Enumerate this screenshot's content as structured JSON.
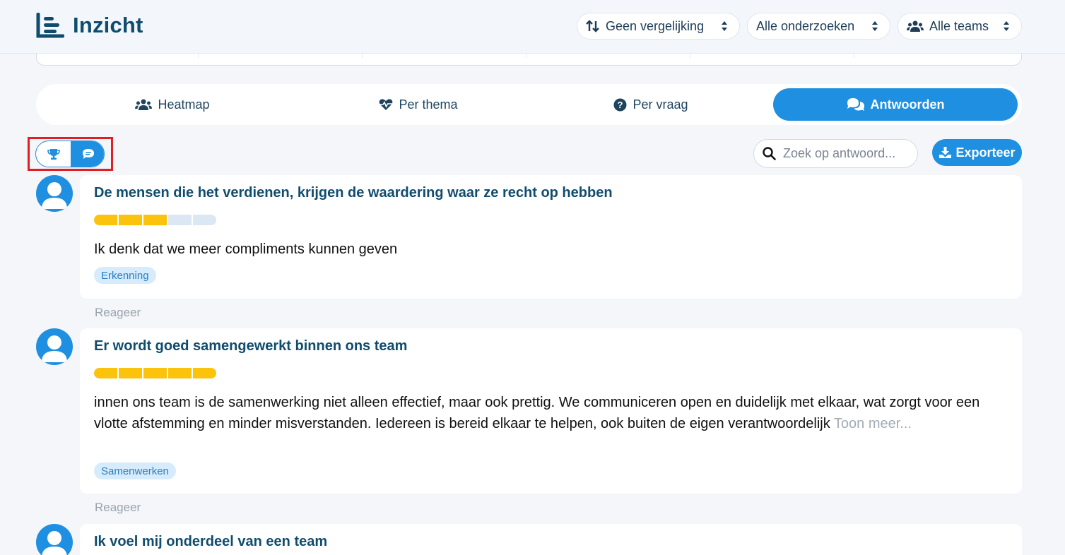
{
  "header": {
    "app_title": "Inzicht",
    "compare_select": "Geen vergelijking",
    "survey_select": "Alle onderzoeken",
    "team_select": "Alle teams"
  },
  "tabs": [
    {
      "label": "Heatmap"
    },
    {
      "label": "Per thema"
    },
    {
      "label": "Per vraag"
    },
    {
      "label": "Antwoorden"
    }
  ],
  "search": {
    "placeholder": "Zoek op antwoord..."
  },
  "export_label": "Exporteer",
  "answers": [
    {
      "question": "De mensen die het verdienen, krijgen de waardering waar ze recht op hebben",
      "rating": 3,
      "rating_max": 5,
      "text": "Ik denk dat we meer compliments kunnen geven",
      "tag": "Erkenning",
      "reply": "Reageer"
    },
    {
      "question": "Er wordt goed samengewerkt binnen ons team",
      "rating": 5,
      "rating_max": 5,
      "text": "innen ons team is de samenwerking niet alleen effectief, maar ook prettig. We communiceren open en duidelijk met elkaar, wat zorgt voor een vlotte afstemming en minder misverstanden. Iedereen is bereid elkaar te helpen, ook buiten de eigen verantwoordelijk",
      "more": "Toon meer...",
      "tag": "Samenwerken",
      "reply": "Reageer"
    },
    {
      "question": "Ik voel mij onderdeel van een team"
    }
  ],
  "colors": {
    "primary": "#1e8fe1",
    "title": "#0f4c6e",
    "rating_filled": "#fbc30b",
    "rating_empty": "#dbe7f3",
    "highlight_box": "#e01e24"
  }
}
